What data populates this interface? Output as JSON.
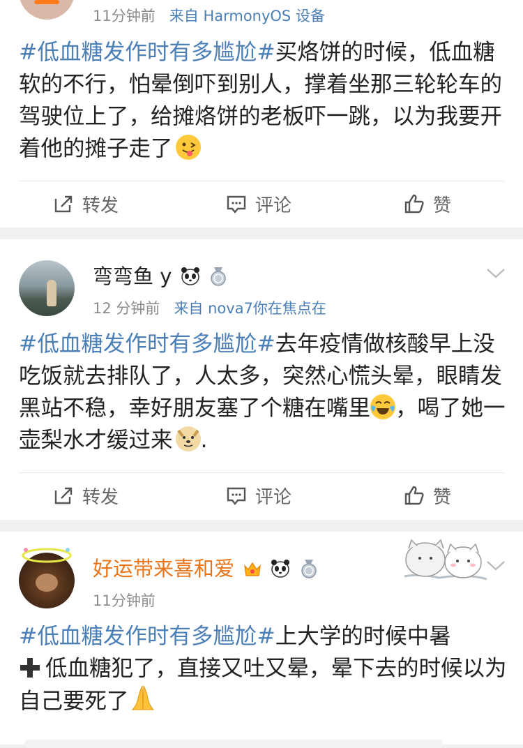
{
  "posts": [
    {
      "time": "11分钟前",
      "source": "来自 HarmonyOS 设备",
      "hashtag": "#低血糖发作时有多尴尬#",
      "text": "买烙饼的时候，低血糖软的不行，怕晕倒吓到别人，撑着坐那三轮轮车的驾驶位上了，给摊烙饼的老板吓一跳，以为我要开着他的摊子走了"
    },
    {
      "name": "弯弯鱼 y",
      "time": "12 分钟前",
      "source": "来自 nova7你在焦点在",
      "hashtag": "#低血糖发作时有多尴尬#",
      "text_part1": "去年疫情做核酸早上没吃饭就去排队了，人太多，突然心慌头晕，眼睛发黑站不稳，幸好朋友塞了个糖在嘴里",
      "text_part2": "，喝了她一壶梨水才缓过来",
      "text_part3": "."
    },
    {
      "name": "好运带来喜和爱",
      "time": "11分钟前",
      "hashtag": "#低血糖发作时有多尴尬#",
      "text_part1": "上大学的时候中暑",
      "text_part2": "低血糖犯了，直接又吐又晕，晕下去的时候以为自己要死了"
    }
  ],
  "actions": {
    "repost": "转发",
    "comment": "评论",
    "like": "赞"
  },
  "colors": {
    "hashtag": "#4b7fb8",
    "vip_name": "#e8751a",
    "meta": "#8c8c8c"
  }
}
